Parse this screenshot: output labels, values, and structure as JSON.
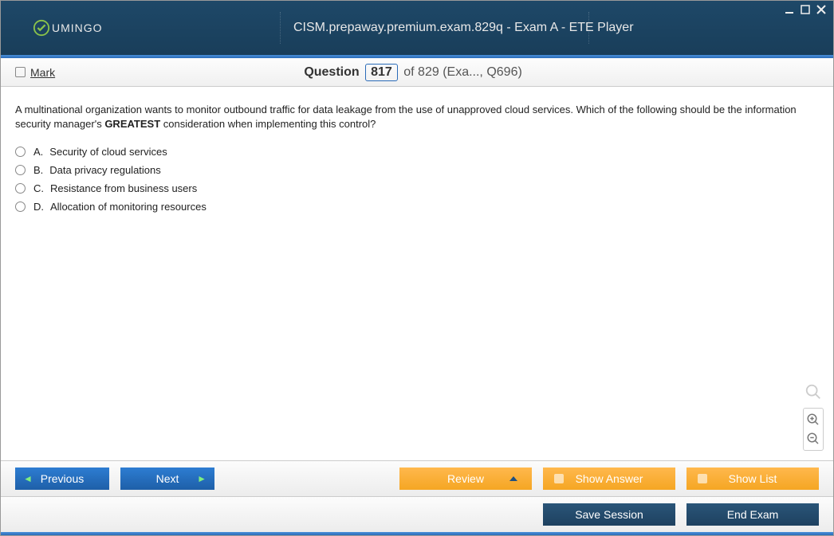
{
  "logo_text": "UMINGO",
  "window_title": "CISM.prepaway.premium.exam.829q - Exam A - ETE Player",
  "mark_label": "Mark",
  "question_label": "Question",
  "question_current": "817",
  "question_total": "of 829 (Exa..., Q696)",
  "question_text_pre": "A multinational organization wants to monitor outbound traffic for data leakage from the use of unapproved cloud services. Which of the following should be the information security manager's ",
  "question_text_bold": "GREATEST",
  "question_text_post": " consideration when implementing this control?",
  "options": [
    {
      "letter": "A.",
      "text": "Security of cloud services"
    },
    {
      "letter": "B.",
      "text": "Data privacy regulations"
    },
    {
      "letter": "C.",
      "text": "Resistance from business users"
    },
    {
      "letter": "D.",
      "text": "Allocation of monitoring resources"
    }
  ],
  "buttons": {
    "previous": "Previous",
    "next": "Next",
    "review": "Review",
    "show_answer": "Show Answer",
    "show_list": "Show List",
    "save_session": "Save Session",
    "end_exam": "End Exam"
  }
}
